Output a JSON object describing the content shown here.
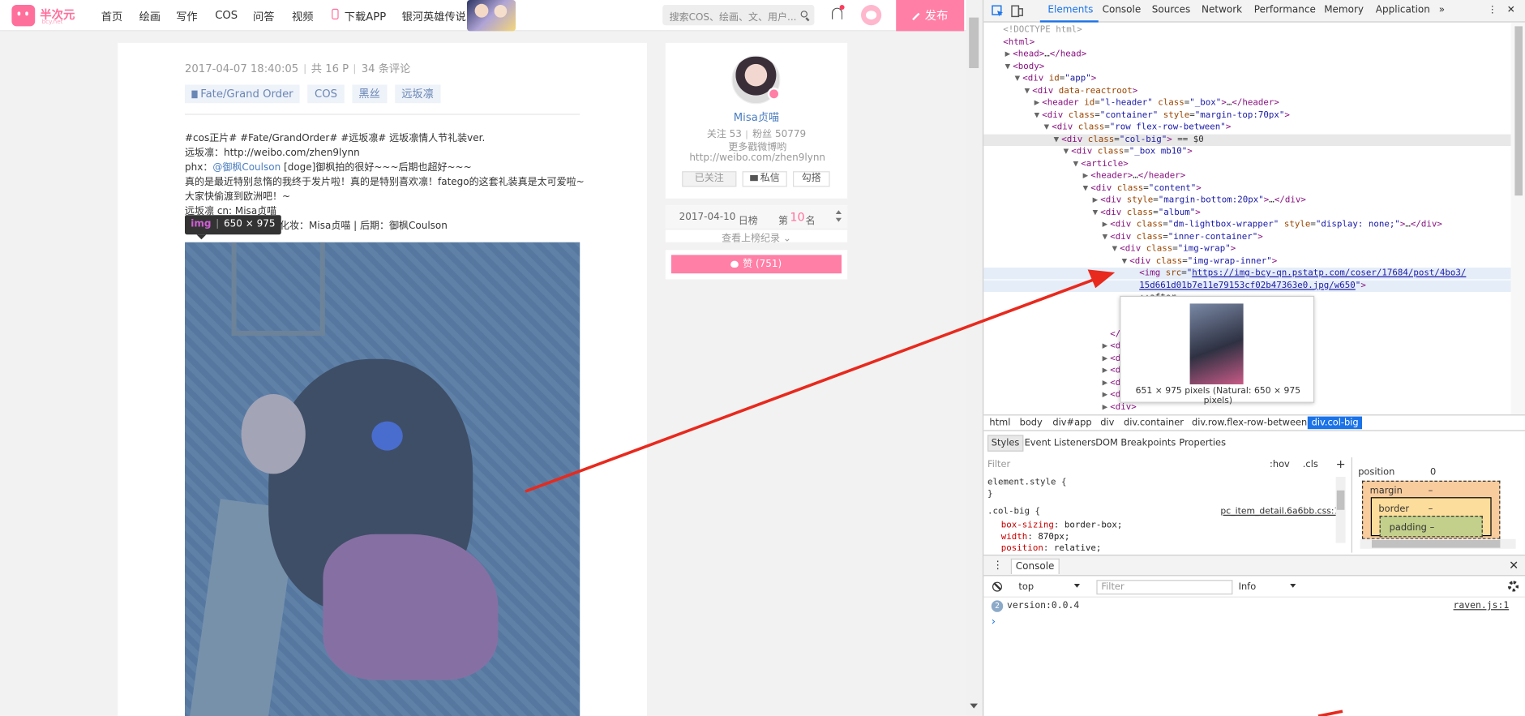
{
  "site": {
    "logo_text": "半次元",
    "logo_sub": "bcy.net",
    "nav": [
      "首页",
      "绘画",
      "写作",
      "COS",
      "问答",
      "视频",
      "下载APP",
      "银河英雄传说"
    ],
    "search_placeholder": "搜索COS、绘画、文、用户...",
    "publish_label": "发布",
    "accent": "#ff7fa7"
  },
  "post": {
    "date": "2017-04-07 18:40:05",
    "pages": "共 16 P",
    "comments": "34 条评论",
    "tags": [
      "Fate/Grand Order",
      "COS",
      "黑丝",
      "远坂凛"
    ],
    "lines": [
      "#cos正片# #Fate/GrandOrder# #远坂凛# 远坂凛情人节礼装ver.",
      "远坂凛：http://weibo.com/zhen9lynn",
      "phx：",
      "@御枫Coulson",
      " [doge]御枫拍的很好~~~后期也超好~~~",
      "真的是最近特别怠惰的我终于发片啦！真的是特别喜欢凛！fatego的这套礼装真是太可爱啦~",
      "大家快偷渡到欧洲吧！~",
      "远坂凛 cn: Misa贞喵",
      "| 化妆：Misa贞喵 | 后期：御枫Coulson"
    ],
    "tooltip_tag": "img",
    "tooltip_size": "650 × 975",
    "highlight_color": "#6fa8dc"
  },
  "profile": {
    "name": "Misa贞喵",
    "follow": "关注 53",
    "fans": "粉丝 50779",
    "intro": "更多戳微博哟http://weibo.com/zhen9lynn",
    "btn_followed": "已关注",
    "btn_message": "私信",
    "btn_tag": "勾搭"
  },
  "rank": {
    "date": "2017-04-10",
    "board": "日榜",
    "prefix": "第",
    "num": "10",
    "suffix": "名",
    "link": "查看上榜纪录"
  },
  "like": {
    "label": "赞 (751)"
  },
  "devtools": {
    "tabs": [
      "Elements",
      "Console",
      "Sources",
      "Network",
      "Performance",
      "Memory",
      "Application"
    ],
    "more": "»",
    "dom": [
      {
        "i": 0,
        "t": "",
        "h": "<span class='cm'>&lt;!DOCTYPE html&gt;</span>"
      },
      {
        "i": 0,
        "t": "",
        "h": "<span class='tg'>&lt;html&gt;</span>"
      },
      {
        "i": 1,
        "t": "▶",
        "h": "<span class='tg'>&lt;head&gt;</span>…<span class='tg'>&lt;/head&gt;</span>"
      },
      {
        "i": 1,
        "t": "▼",
        "h": "<span class='tg'>&lt;body&gt;</span>"
      },
      {
        "i": 2,
        "t": "▼",
        "h": "<span class='tg'>&lt;div</span> <span class='at'>id</span>=<span class='av'>\"app\"</span><span class='tg'>&gt;</span>"
      },
      {
        "i": 3,
        "t": "▼",
        "h": "<span class='tg'>&lt;div</span> <span class='at'>data-reactroot</span><span class='tg'>&gt;</span>"
      },
      {
        "i": 4,
        "t": "▶",
        "h": "<span class='tg'>&lt;header</span> <span class='at'>id</span>=<span class='av'>\"l-header\"</span> <span class='at'>class</span>=<span class='av'>\"_box\"</span><span class='tg'>&gt;</span>…<span class='tg'>&lt;/header&gt;</span>"
      },
      {
        "i": 4,
        "t": "▼",
        "h": "<span class='tg'>&lt;div</span> <span class='at'>class</span>=<span class='av'>\"container\"</span> <span class='at'>style</span>=<span class='av'>\"margin-top:70px\"</span><span class='tg'>&gt;</span>"
      },
      {
        "i": 5,
        "t": "▼",
        "h": "<span class='tg'>&lt;div</span> <span class='at'>class</span>=<span class='av'>\"row flex-row-between\"</span><span class='tg'>&gt;</span>"
      },
      {
        "i": 6,
        "t": "▼",
        "h": "<span class='tg'>&lt;div</span> <span class='at'>class</span>=<span class='av'>\"col-big\"</span><span class='tg'>&gt;</span> == $0",
        "sel": true
      },
      {
        "i": 7,
        "t": "▼",
        "h": "<span class='tg'>&lt;div</span> <span class='at'>class</span>=<span class='av'>\"_box mb10\"</span><span class='tg'>&gt;</span>"
      },
      {
        "i": 8,
        "t": "▼",
        "h": "<span class='tg'>&lt;article&gt;</span>"
      },
      {
        "i": 9,
        "t": "▶",
        "h": "<span class='tg'>&lt;header&gt;</span>…<span class='tg'>&lt;/header&gt;</span>"
      },
      {
        "i": 9,
        "t": "▼",
        "h": "<span class='tg'>&lt;div</span> <span class='at'>class</span>=<span class='av'>\"content\"</span><span class='tg'>&gt;</span>"
      },
      {
        "i": 10,
        "t": "▶",
        "h": "<span class='tg'>&lt;div</span> <span class='at'>style</span>=<span class='av'>\"margin-bottom:20px\"</span><span class='tg'>&gt;</span>…<span class='tg'>&lt;/div&gt;</span>"
      },
      {
        "i": 10,
        "t": "▼",
        "h": "<span class='tg'>&lt;div</span> <span class='at'>class</span>=<span class='av'>\"album\"</span><span class='tg'>&gt;</span>"
      },
      {
        "i": 11,
        "t": "▶",
        "h": "<span class='tg'>&lt;div</span> <span class='at'>class</span>=<span class='av'>\"dm-lightbox-wrapper\"</span> <span class='at'>style</span>=<span class='av'>\"display: none;\"</span><span class='tg'>&gt;</span>…<span class='tg'>&lt;/div&gt;</span>"
      },
      {
        "i": 11,
        "t": "▼",
        "h": "<span class='tg'>&lt;div</span> <span class='at'>class</span>=<span class='av'>\"inner-container\"</span><span class='tg'>&gt;</span>"
      },
      {
        "i": 12,
        "t": "▼",
        "h": "<span class='tg'>&lt;div</span> <span class='at'>class</span>=<span class='av'>\"img-wrap\"</span><span class='tg'>&gt;</span>"
      },
      {
        "i": 13,
        "t": "▼",
        "h": "<span class='tg'>&lt;div</span> <span class='at'>class</span>=<span class='av'>\"img-wrap-inner\"</span><span class='tg'>&gt;</span>"
      },
      {
        "i": 14,
        "t": "",
        "h": "<span class='tg'>&lt;img</span> <span class='at'>src</span>=<span class='av'>\"</span><span class='lk'>https://img-bcy-qn.pstatp.com/coser/17684/post/4bo3/</span>",
        "hov": true
      },
      {
        "i": 14,
        "t": "",
        "h": "<span class='lk'>15d661d01b7e11e79153cf02b47363e0.jpg/w650</span><span class='av'>\"</span><span class='tg'>&gt;</span>",
        "hov": true
      },
      {
        "i": 14,
        "t": "",
        "h": "::after"
      },
      {
        "i": 13,
        "t": "",
        "h": "<span class='tg'>&lt;/div&gt;</span>"
      },
      {
        "i": 12,
        "t": "",
        "h": "<span class='tg'>&lt;/div&gt;</span>"
      },
      {
        "i": 11,
        "t": "",
        "h": "<span class='tg'>&lt;/div&gt;</span>"
      },
      {
        "i": 11,
        "t": "▶",
        "h": "<span class='tg'>&lt;div&gt;</span>"
      },
      {
        "i": 11,
        "t": "▶",
        "h": "<span class='tg'>&lt;div&gt;</span>"
      },
      {
        "i": 11,
        "t": "▶",
        "h": "<span class='tg'>&lt;div&gt;</span>"
      },
      {
        "i": 11,
        "t": "▶",
        "h": "<span class='tg'>&lt;div&gt;</span>"
      },
      {
        "i": 11,
        "t": "▶",
        "h": "<span class='tg'>&lt;div&gt;</span>"
      },
      {
        "i": 11,
        "t": "▶",
        "h": "<span class='tg'>&lt;div&gt;</span>"
      }
    ],
    "img_preview": "651 × 975 pixels (Natural: 650 × 975 pixels)",
    "breadcrumbs": [
      "html",
      "body",
      "div#app",
      "div",
      "div.container",
      "div.row.flex-row-between",
      "div.col-big"
    ],
    "style_tabs": [
      "Styles",
      "Event Listeners",
      "DOM Breakpoints",
      "Properties"
    ],
    "filter_label": "Filter",
    "hov": ":hov",
    "cls": ".cls",
    "plus": "+",
    "rules": {
      "element_style": "element.style {",
      "close": "}",
      "col_big": ".col-big {",
      "source": "pc_item_detail.6a6bb.css:1",
      "p1": "box-sizing",
      "v1": "border-box;",
      "p2": "width",
      "v2": "870px;",
      "p3": "position",
      "v3": "relative;"
    },
    "box": {
      "position": "position",
      "position_val": "0",
      "margin": "margin",
      "border": "border",
      "padding": "padding",
      "dash": "–"
    },
    "console_tab": "Console",
    "context": "top",
    "console_filter": "Filter",
    "level": "Info",
    "msg_count": "2",
    "msg_text": "version:0.0.4",
    "msg_src": "raven.js:1",
    "prompt": "›"
  }
}
